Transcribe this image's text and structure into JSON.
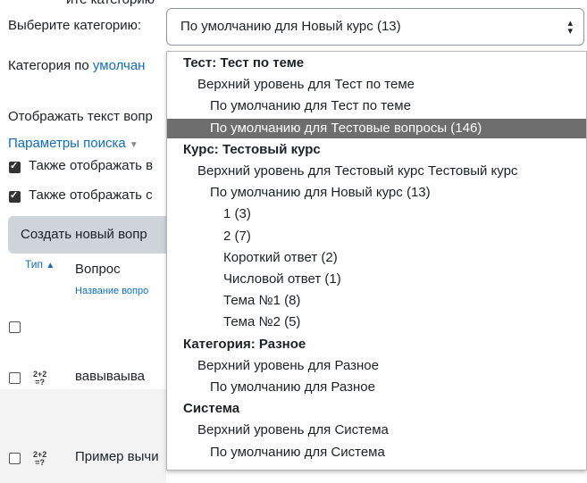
{
  "top_partial_text": "ите категорию",
  "category_label": "Выберите категорию:",
  "category_select": {
    "value": "По умолчанию для Новый курс (13)"
  },
  "category_desc": {
    "prefix": "Категория по ",
    "link": "умолчан"
  },
  "show_text_label": "Отображать текст вопр",
  "search_params": "Параметры поиска",
  "options": [
    {
      "label": "Также отображать в",
      "checked": true
    },
    {
      "label": "Также отображать с",
      "checked": true
    }
  ],
  "create_button": "Создать новый вопр",
  "table": {
    "col_type": "Тип",
    "col_question": "Вопрос",
    "col_question_sub": "Название вопро",
    "rows": [
      {
        "icon": "2+2\n=?",
        "name": "вавываыва"
      },
      {
        "icon": "2+2\n=?",
        "name": "Пример вычи"
      }
    ]
  },
  "dropdown": [
    {
      "kind": "group",
      "label": "Тест: Тест по теме"
    },
    {
      "kind": "item",
      "level": 1,
      "label": "Верхний уровень для Тест по теме"
    },
    {
      "kind": "item",
      "level": 2,
      "label": "По умолчанию для Тест по теме"
    },
    {
      "kind": "item",
      "level": 2,
      "label": "По умолчанию для Тестовые вопросы (146)",
      "selected": true
    },
    {
      "kind": "group",
      "label": "Курс: Тестовый курс"
    },
    {
      "kind": "item",
      "level": 1,
      "label": "Верхний уровень для Тестовый курс Тестовый курс"
    },
    {
      "kind": "item",
      "level": 2,
      "label": "По умолчанию для Новый курс (13)"
    },
    {
      "kind": "item",
      "level": 3,
      "label": "1 (3)"
    },
    {
      "kind": "item",
      "level": 3,
      "label": "2 (7)"
    },
    {
      "kind": "item",
      "level": 3,
      "label": "Короткий ответ (2)"
    },
    {
      "kind": "item",
      "level": 3,
      "label": "Числовой ответ (1)"
    },
    {
      "kind": "item",
      "level": 3,
      "label": "Тема №1 (8)"
    },
    {
      "kind": "item",
      "level": 3,
      "label": "Тема №2 (5)"
    },
    {
      "kind": "group",
      "label": "Категория: Разное"
    },
    {
      "kind": "item",
      "level": 1,
      "label": "Верхний уровень для Разное"
    },
    {
      "kind": "item",
      "level": 2,
      "label": "По умолчанию для Разное"
    },
    {
      "kind": "group",
      "label": "Система"
    },
    {
      "kind": "item",
      "level": 1,
      "label": "Верхний уровень для Система"
    },
    {
      "kind": "item",
      "level": 2,
      "label": "По умолчанию для Система"
    }
  ]
}
